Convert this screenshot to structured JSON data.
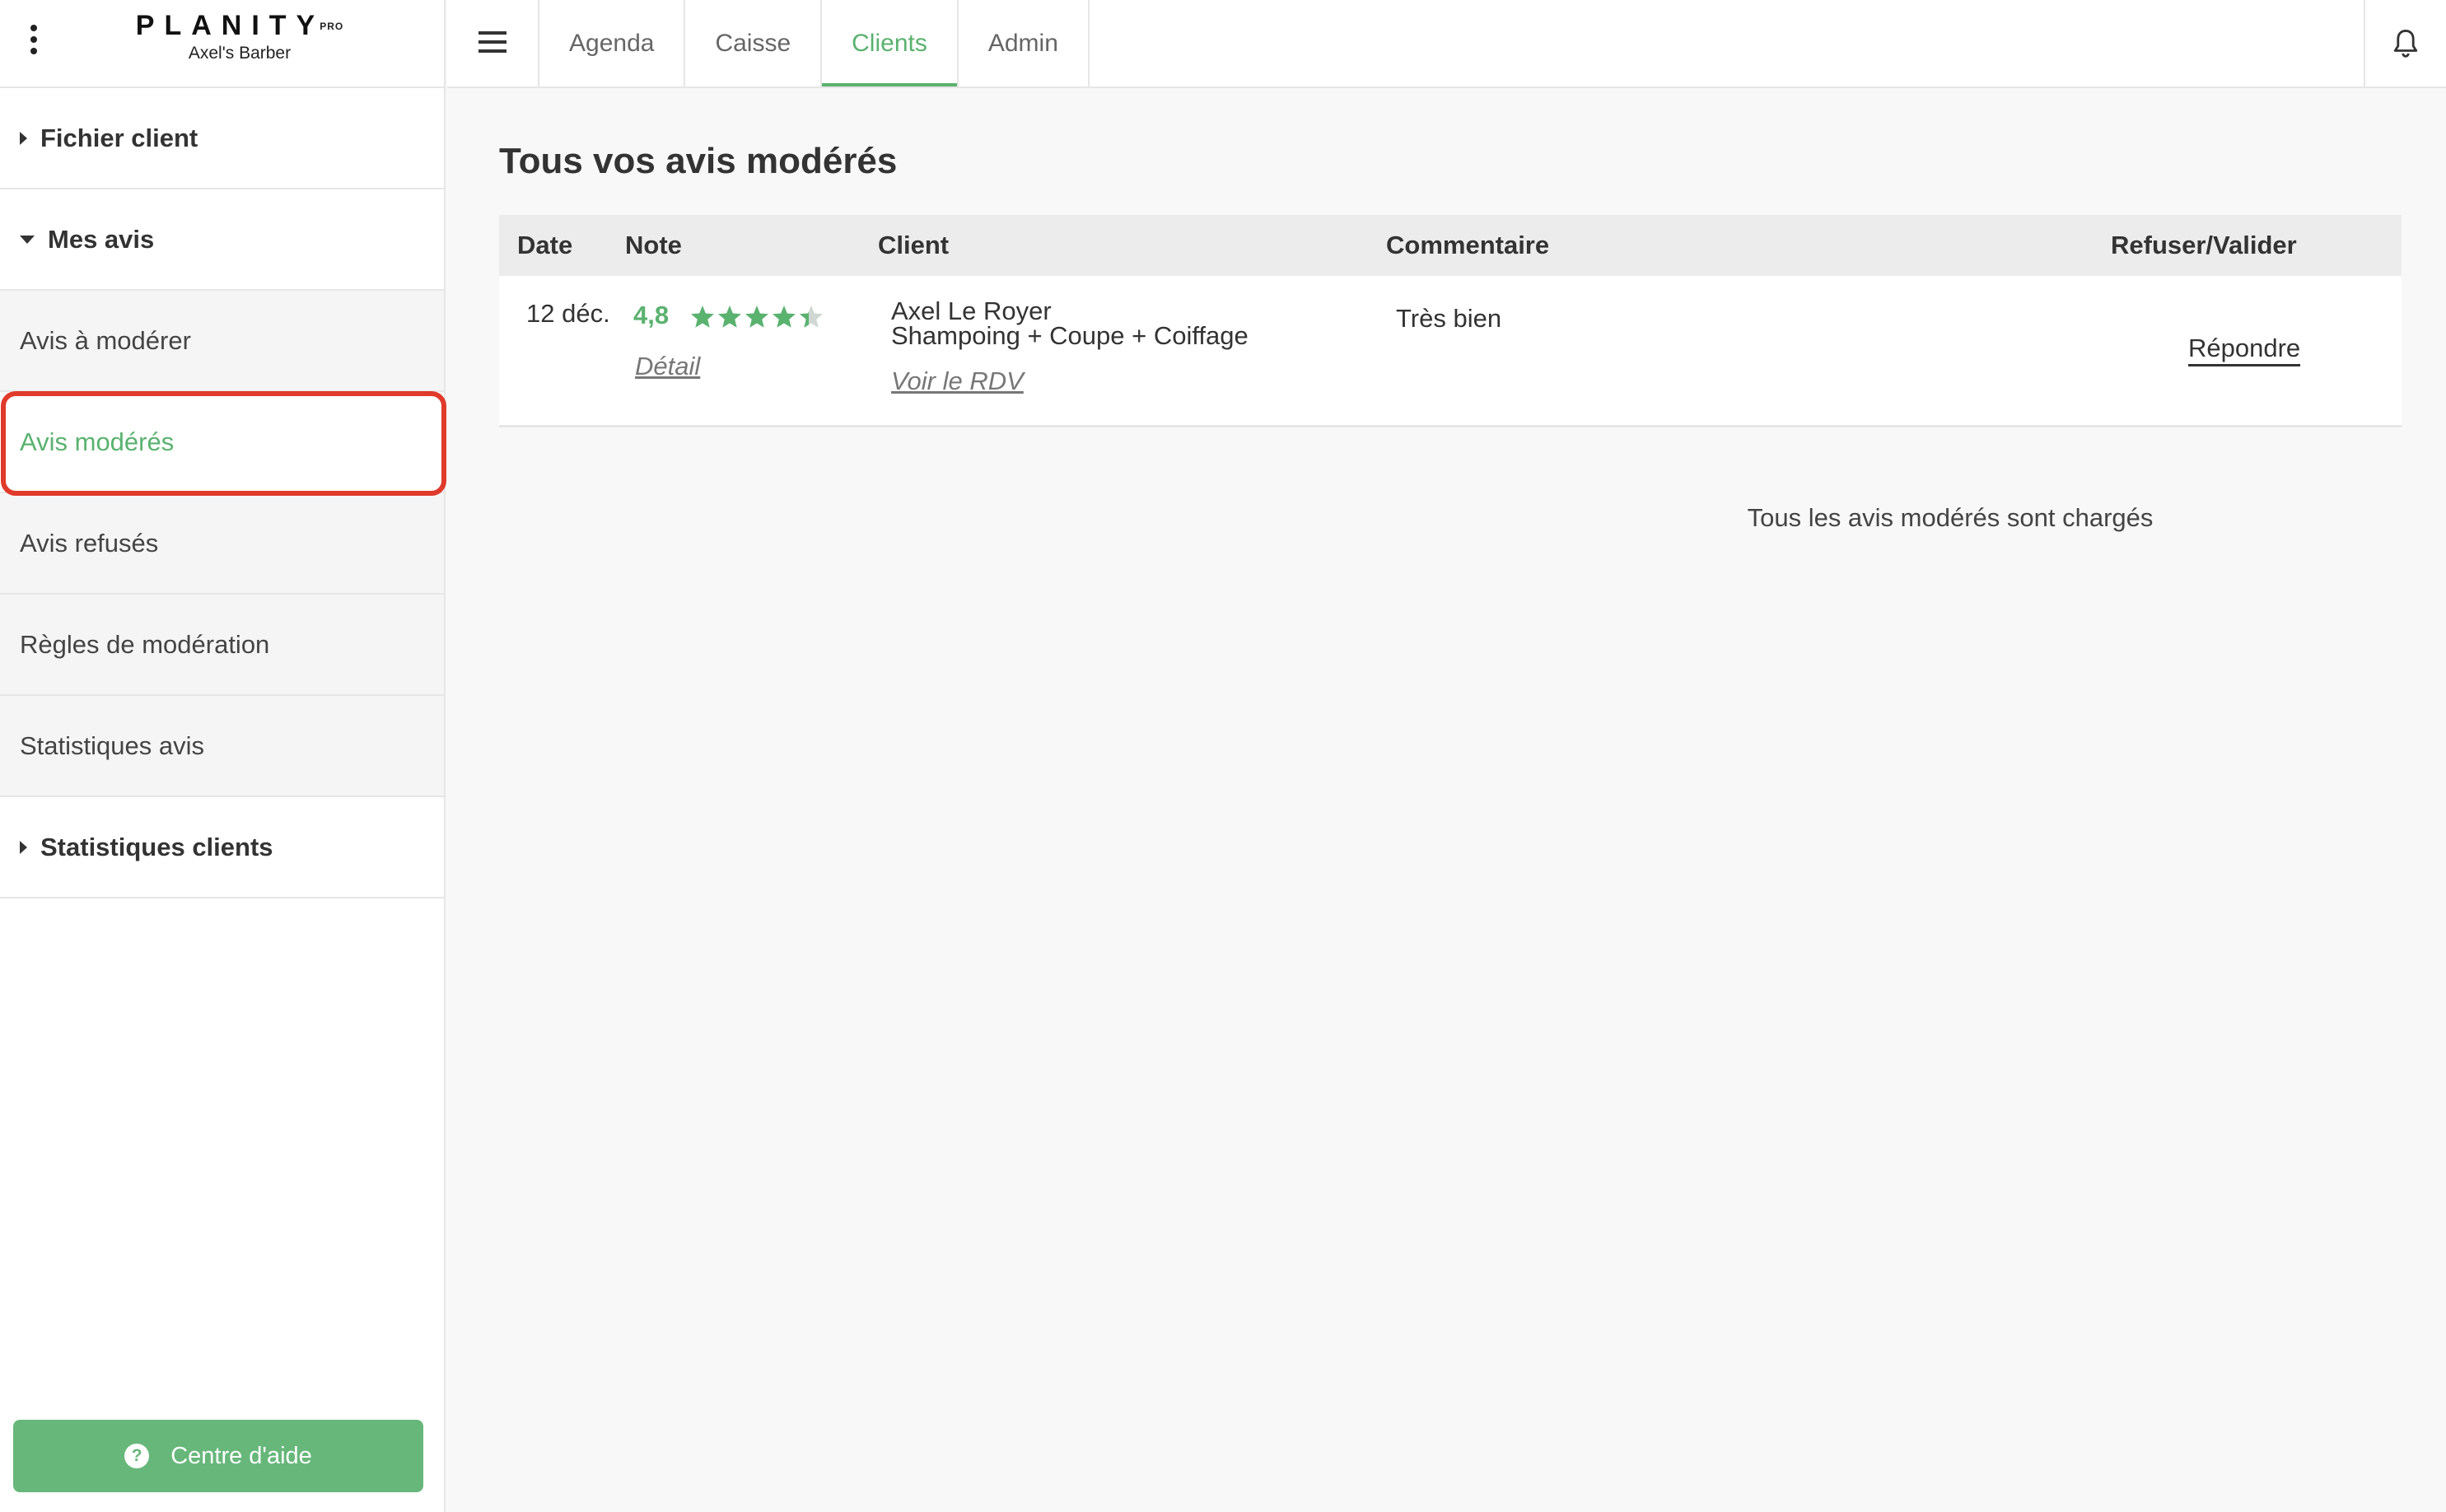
{
  "brand": {
    "name": "PLANITY",
    "pro": "PRO",
    "salon": "Axel's Barber"
  },
  "sidebar": {
    "sections": [
      {
        "label": "Fichier client",
        "expanded": false
      },
      {
        "label": "Mes avis",
        "expanded": true
      },
      {
        "label": "Statistiques clients",
        "expanded": false
      }
    ],
    "subitems": [
      {
        "label": "Avis à modérer"
      },
      {
        "label": "Avis modérés",
        "active": true
      },
      {
        "label": "Avis refusés"
      },
      {
        "label": "Règles de modération"
      },
      {
        "label": "Statistiques avis"
      }
    ],
    "help_label": "Centre d'aide",
    "help_glyph": "?"
  },
  "topnav": {
    "tabs": [
      {
        "label": "Agenda"
      },
      {
        "label": "Caisse"
      },
      {
        "label": "Clients",
        "active": true
      },
      {
        "label": "Admin"
      }
    ]
  },
  "main": {
    "title": "Tous vos avis modérés",
    "columns": {
      "date": "Date",
      "note": "Note",
      "client": "Client",
      "comment": "Commentaire",
      "action": "Refuser/Valider"
    },
    "rows": [
      {
        "date": "12 déc.",
        "rating": "4,8",
        "stars": 4.8,
        "detail_link": "Détail",
        "client_name": "Axel Le Royer",
        "service": "Shampoing + Coupe + Coiffage",
        "rdv_link": "Voir le RDV",
        "comment": "Très bien",
        "reply_label": "Répondre"
      }
    ],
    "footer_note": "Tous les avis modérés sont chargés"
  },
  "colors": {
    "accent": "#5ab26f",
    "help_button": "#67b77b",
    "highlight": "#e03a2b"
  }
}
